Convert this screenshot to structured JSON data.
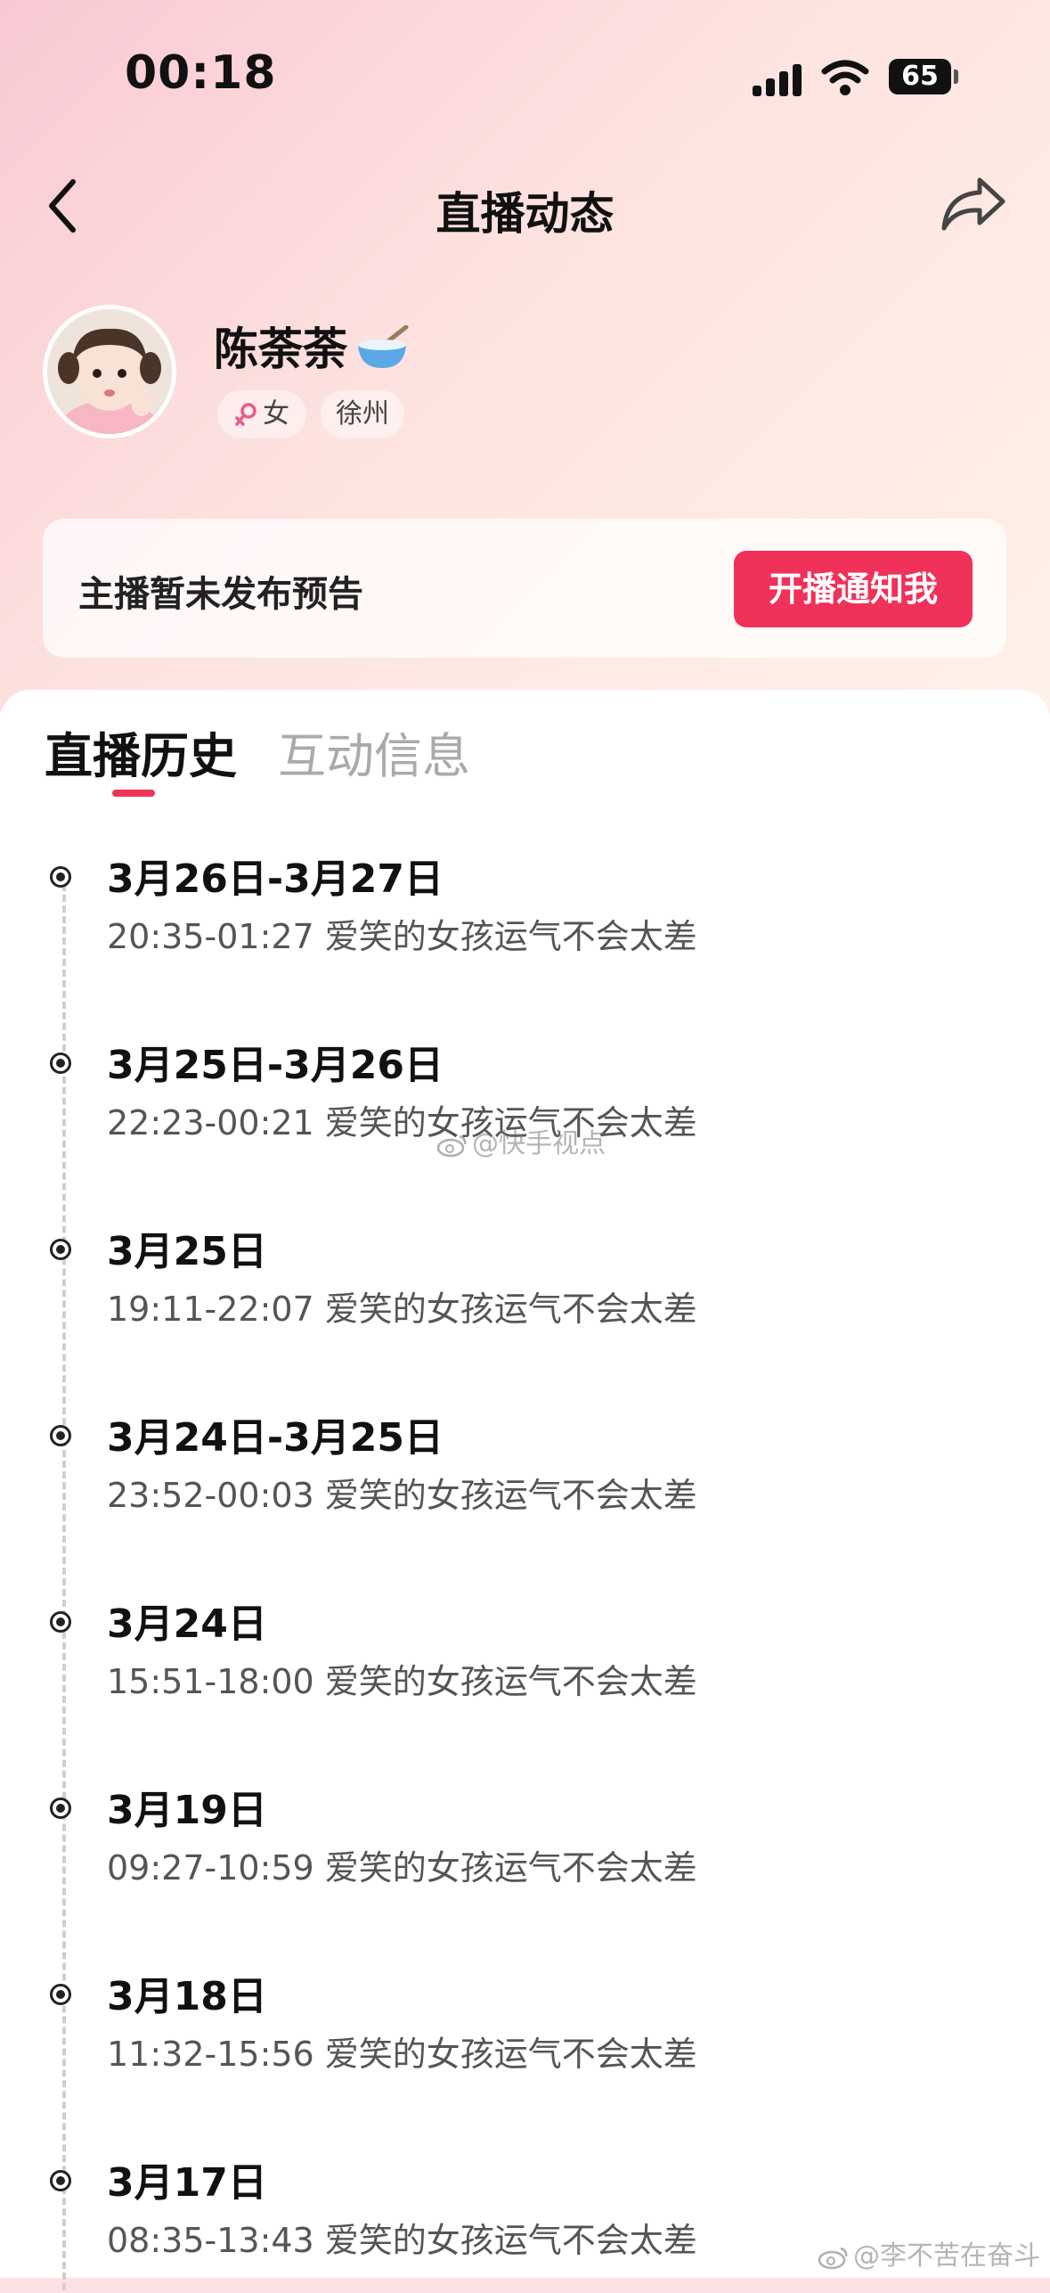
{
  "status_bar": {
    "time": "00:18",
    "battery": "65"
  },
  "nav": {
    "title": "直播动态"
  },
  "profile": {
    "name": "陈荼荼",
    "name_emoji": "🥣",
    "gender": "女",
    "city": "徐州"
  },
  "notice": {
    "text": "主播暂未发布预告",
    "button_label": "开播通知我"
  },
  "tabs": [
    {
      "label": "直播历史",
      "active": true
    },
    {
      "label": "互动信息",
      "active": false
    }
  ],
  "history": [
    {
      "date": "3月26日-3月27日",
      "detail": "20:35-01:27 爱笑的女孩运气不会太差"
    },
    {
      "date": "3月25日-3月26日",
      "detail": "22:23-00:21 爱笑的女孩运气不会太差"
    },
    {
      "date": "3月25日",
      "detail": "19:11-22:07 爱笑的女孩运气不会太差"
    },
    {
      "date": "3月24日-3月25日",
      "detail": "23:52-00:03 爱笑的女孩运气不会太差"
    },
    {
      "date": "3月24日",
      "detail": "15:51-18:00 爱笑的女孩运气不会太差"
    },
    {
      "date": "3月19日",
      "detail": "09:27-10:59 爱笑的女孩运气不会太差"
    },
    {
      "date": "3月18日",
      "detail": "11:32-15:56 爱笑的女孩运气不会太差"
    },
    {
      "date": "3月17日",
      "detail": "08:35-13:43 爱笑的女孩运气不会太差"
    }
  ],
  "watermarks": {
    "middle": "@快手视点",
    "bottom": "@李不苦在奋斗"
  },
  "colors": {
    "accent": "#f0315a"
  }
}
